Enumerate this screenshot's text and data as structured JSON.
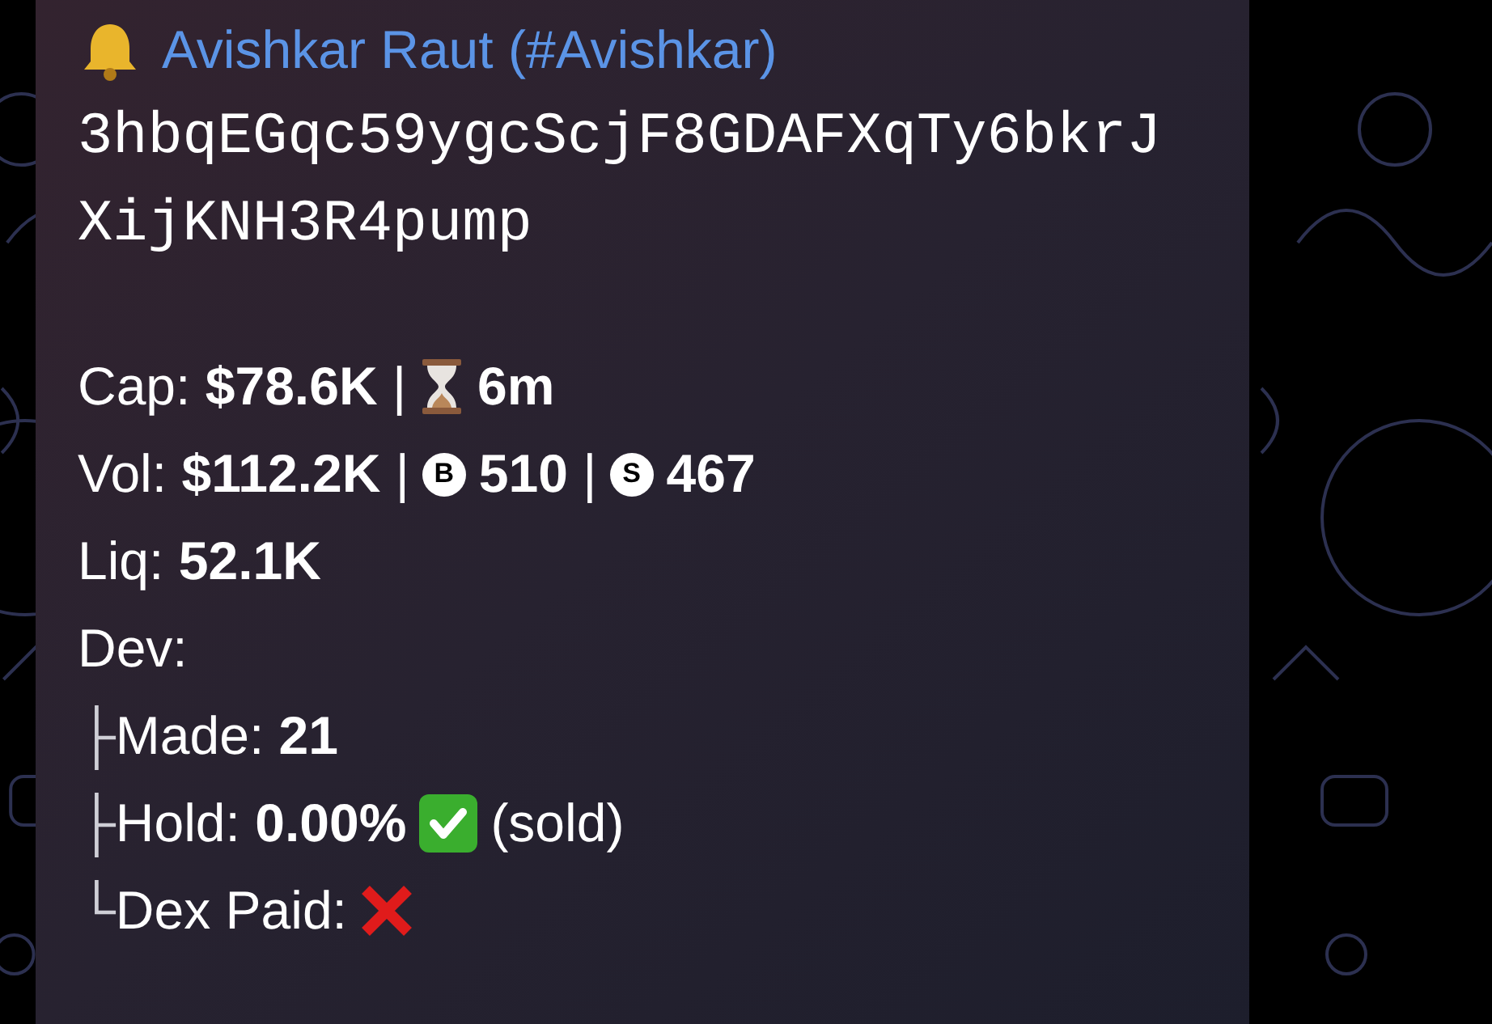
{
  "message": {
    "sender": {
      "name": "Avishkar Raut (#Avishkar)"
    },
    "address_lines": [
      "3hbqEGqc59ygcScjF8GDAFXqTy6bkrJ",
      "XijKNH3R4pump"
    ],
    "lines": [
      {
        "segments": [
          {
            "kind": "text",
            "text": "Cap: **$78.6K** |"
          },
          {
            "kind": "hourglass"
          },
          {
            "kind": "text",
            "text": "**6m**"
          }
        ]
      },
      {
        "segments": [
          {
            "kind": "text",
            "text": "Vol: **$112.2K** |"
          },
          {
            "kind": "badge",
            "text": "B"
          },
          {
            "kind": "text",
            "text": "**510** |"
          },
          {
            "kind": "badge",
            "text": "S"
          },
          {
            "kind": "text",
            "text": "**467**"
          }
        ]
      },
      {
        "segments": [
          {
            "kind": "text",
            "text": "Liq: **52.1K**"
          }
        ]
      },
      {
        "segments": [
          {
            "kind": "text",
            "text": "Dev:"
          }
        ]
      },
      {
        "segments": [
          {
            "kind": "branch",
            "text": "├"
          },
          {
            "kind": "text",
            "text": "Made: **21**"
          }
        ]
      },
      {
        "segments": [
          {
            "kind": "branch",
            "text": "├"
          },
          {
            "kind": "text",
            "text": "Hold: **0.00%**"
          },
          {
            "kind": "check"
          },
          {
            "kind": "text",
            "text": "(sold)"
          }
        ]
      },
      {
        "segments": [
          {
            "kind": "branch",
            "text": "└"
          },
          {
            "kind": "text",
            "text": "Dex Paid:"
          },
          {
            "kind": "cross"
          }
        ]
      }
    ]
  }
}
